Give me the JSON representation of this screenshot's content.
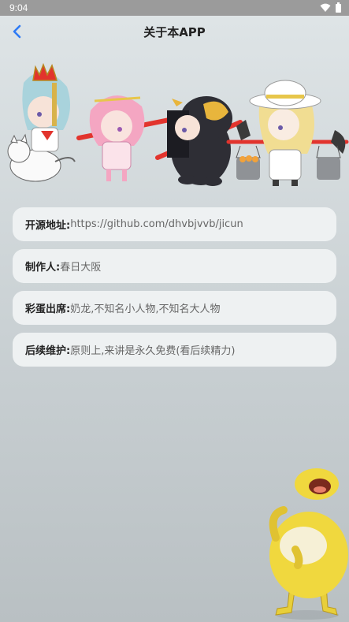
{
  "status_bar": {
    "time": "9:04"
  },
  "header": {
    "title": "关于本APP",
    "back_icon": "chevron-left-icon"
  },
  "colors": {
    "accent": "#2f7bf5",
    "card_bg": "#eef1f2",
    "status_bar_bg": "#9b9b9b"
  },
  "info": [
    {
      "label": "开源地址:",
      "value": "https://github.com/dhvbjvvb/jicun"
    },
    {
      "label": "制作人:",
      "value": "春日大阪"
    },
    {
      "label": "彩蛋出席:",
      "value": "奶龙,不知名小人物,不知名大人物"
    },
    {
      "label": "后续维护:",
      "value": "原则上,来讲是永久免费(看后续精力)"
    }
  ]
}
